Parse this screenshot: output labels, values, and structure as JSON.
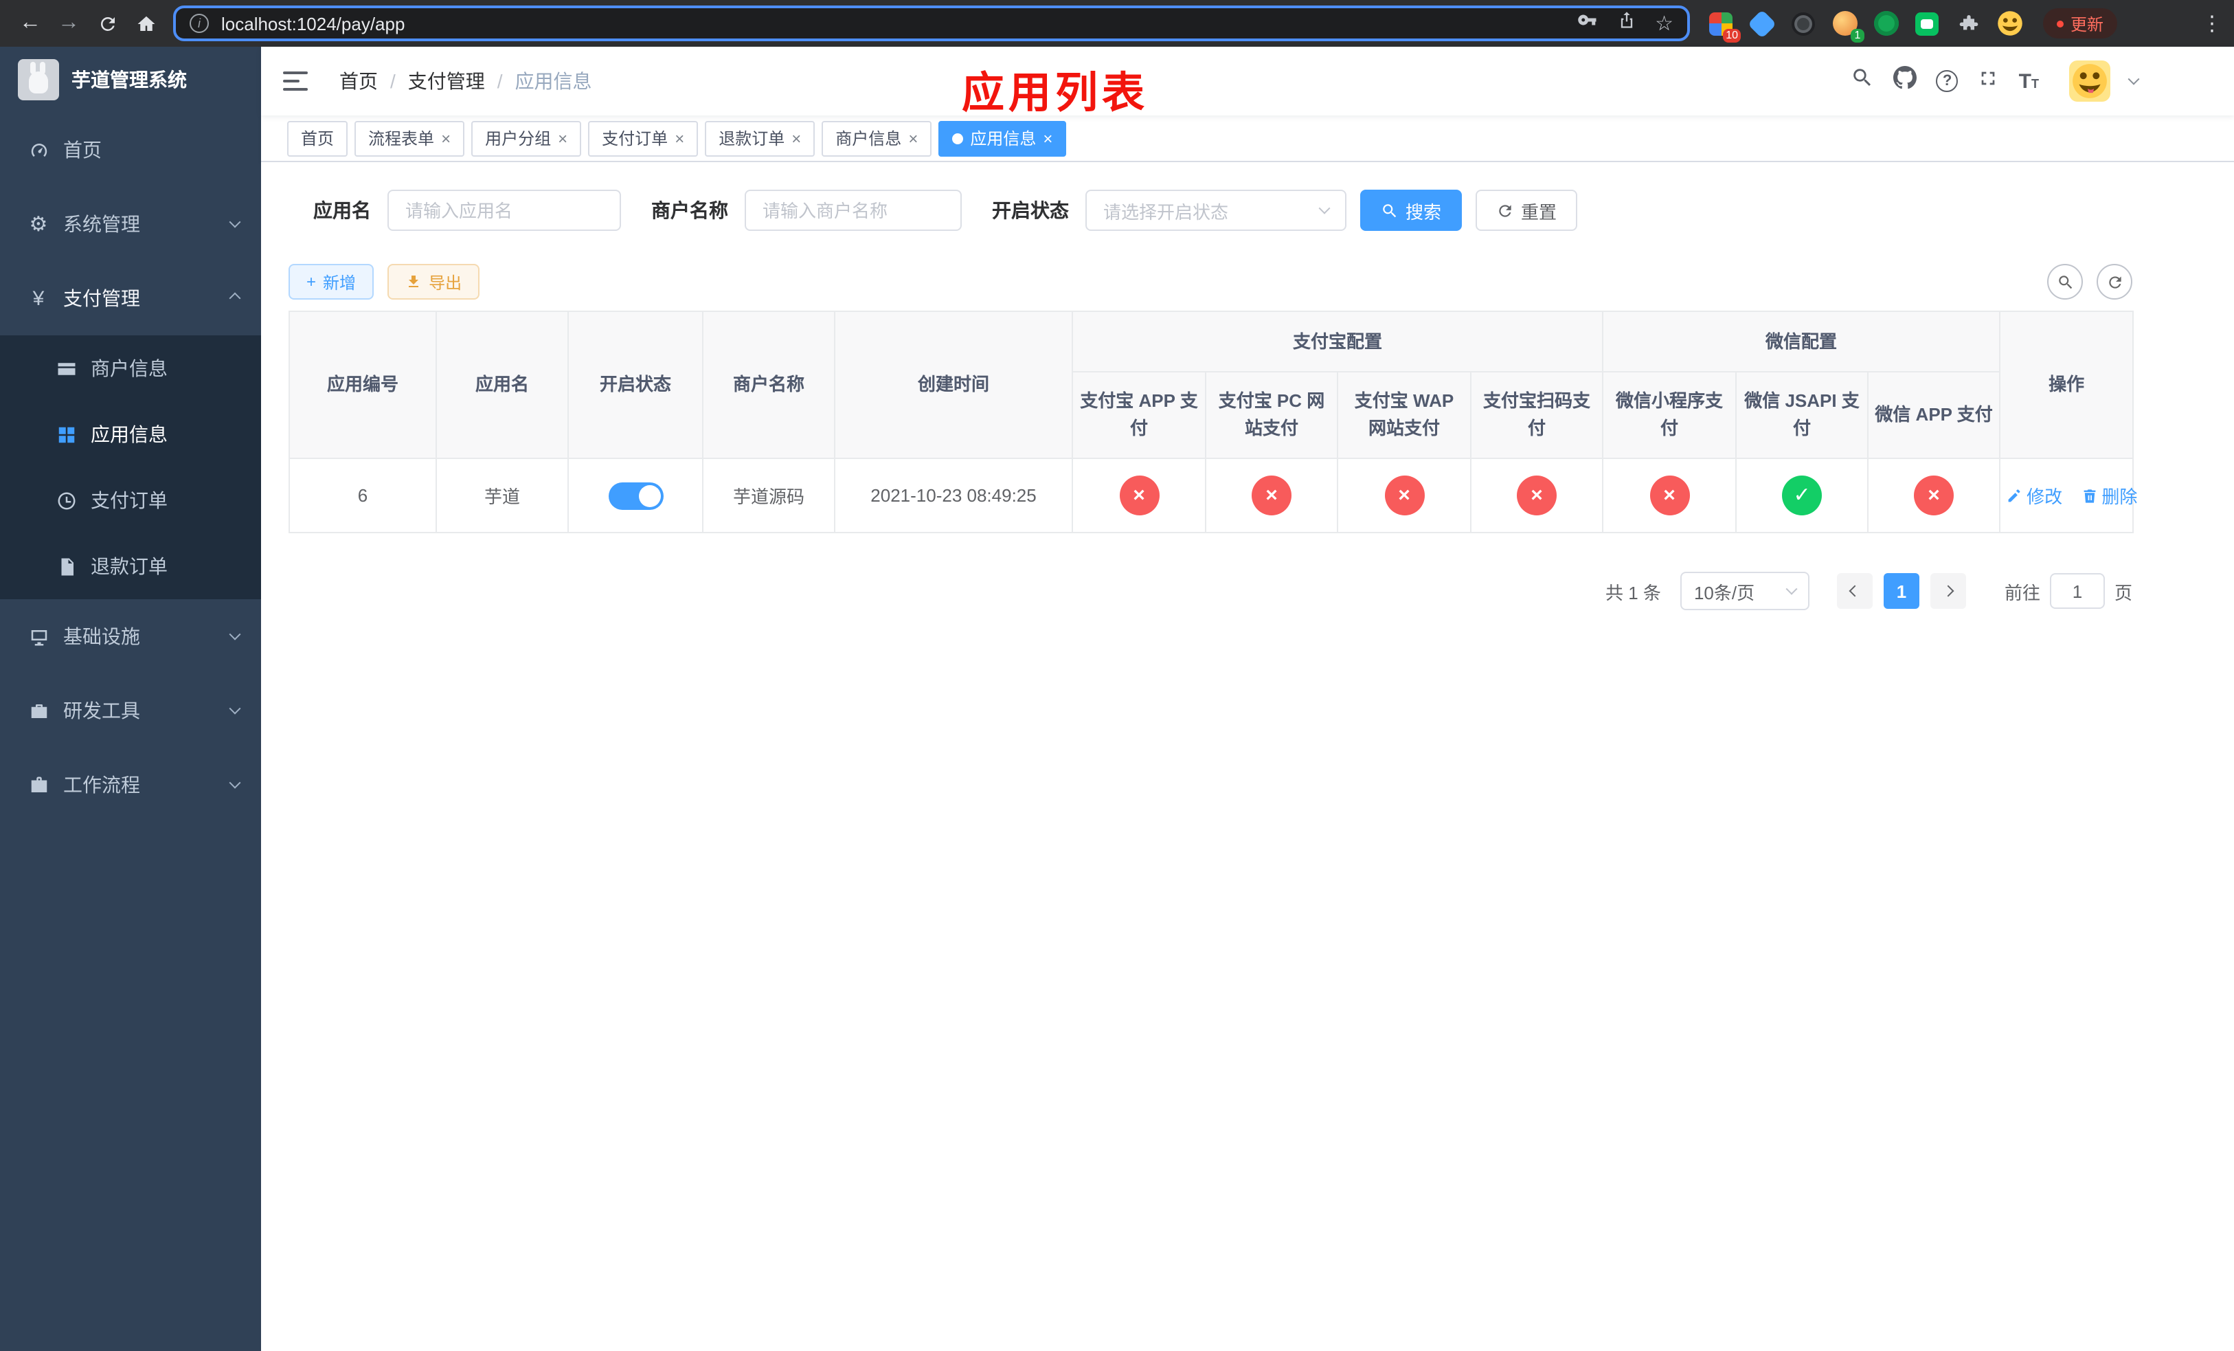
{
  "colors": {
    "accent": "#409eff",
    "danger": "#f85b5b",
    "success": "#13ce66",
    "warning": "#e6a23c",
    "title_red": "#f2150d",
    "sidebar_bg": "#304156",
    "submenu_bg": "#1f2d3d"
  },
  "icons": {
    "back": "←",
    "forward": "→",
    "info": "i",
    "star": "☆",
    "menu_dots": "⋮",
    "gear": "⚙",
    "yen": "¥",
    "question": "?",
    "font_large": "T",
    "font_small": "T",
    "close": "×",
    "check": "✓",
    "cross": "×",
    "plus": "+"
  },
  "browser": {
    "url": "localhost:1024/pay/app",
    "update_label": "更新",
    "extension_badges": {
      "grid": "10",
      "avatar": "1"
    }
  },
  "sidebar": {
    "title": "芋道管理系统",
    "items": [
      {
        "label": "首页"
      },
      {
        "label": "系统管理"
      },
      {
        "label": "支付管理"
      },
      {
        "label": "商户信息"
      },
      {
        "label": "应用信息"
      },
      {
        "label": "支付订单"
      },
      {
        "label": "退款订单"
      },
      {
        "label": "基础设施"
      },
      {
        "label": "研发工具"
      },
      {
        "label": "工作流程"
      }
    ]
  },
  "navbar": {
    "breadcrumb": [
      {
        "label": "首页"
      },
      {
        "label": "支付管理"
      },
      {
        "label": "应用信息"
      }
    ],
    "separator": "/",
    "page_title": "应用列表"
  },
  "tabs": [
    {
      "label": "首页"
    },
    {
      "label": "流程表单"
    },
    {
      "label": "用户分组"
    },
    {
      "label": "支付订单"
    },
    {
      "label": "退款订单"
    },
    {
      "label": "商户信息"
    },
    {
      "label": "应用信息"
    }
  ],
  "filters": {
    "app_name": {
      "label": "应用名",
      "placeholder": "请输入应用名"
    },
    "merchant_name": {
      "label": "商户名称",
      "placeholder": "请输入商户名称"
    },
    "status": {
      "label": "开启状态",
      "placeholder": "请选择开启状态"
    },
    "search_label": "搜索",
    "reset_label": "重置"
  },
  "toolbar": {
    "add_label": "新增",
    "export_label": "导出"
  },
  "table": {
    "header": {
      "app_id": "应用编号",
      "app_name": "应用名",
      "status": "开启状态",
      "merchant_name": "商户名称",
      "created_at": "创建时间",
      "alipay_group": "支付宝配置",
      "wechat_group": "微信配置",
      "actions": "操作",
      "pay_columns": [
        "支付宝 APP 支付",
        "支付宝 PC 网站支付",
        "支付宝 WAP 网站支付",
        "支付宝扫码支付",
        "微信小程序支付",
        "微信 JSAPI 支付",
        "微信 APP 支付"
      ]
    },
    "rows": [
      {
        "app_id": "6",
        "app_name": "芋道",
        "status_on": true,
        "merchant_name": "芋道源码",
        "created_at": "2021-10-23 08:49:25",
        "pay_flags": [
          "disabled",
          "disabled",
          "disabled",
          "disabled",
          "disabled",
          "enabled",
          "disabled"
        ],
        "edit_label": "修改",
        "delete_label": "删除"
      }
    ]
  },
  "pagination": {
    "total_text": "共 1 条",
    "page_size_text": "10条/页",
    "current_page": "1",
    "goto_label": "前往",
    "goto_value": "1",
    "page_unit": "页"
  }
}
